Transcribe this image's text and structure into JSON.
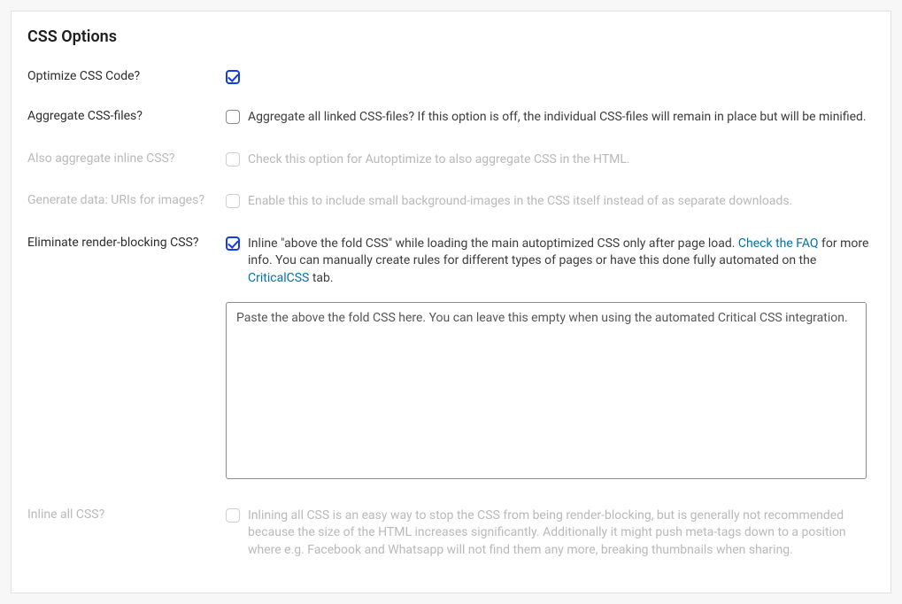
{
  "section_title": "CSS Options",
  "rows": {
    "optimize": {
      "label": "Optimize CSS Code?",
      "desc": ""
    },
    "aggregate": {
      "label": "Aggregate CSS-files?",
      "desc": "Aggregate all linked CSS-files? If this option is off, the individual CSS-files will remain in place but will be minified."
    },
    "inline_agg": {
      "label": "Also aggregate inline CSS?",
      "desc": "Check this option for Autoptimize to also aggregate CSS in the HTML."
    },
    "data_uri": {
      "label": "Generate data: URIs for images?",
      "desc": "Enable this to include small background-images in the CSS itself instead of as separate downloads."
    },
    "eliminate": {
      "label": "Eliminate render-blocking CSS?",
      "desc_1": "Inline \"above the fold CSS\" while loading the main autoptimized CSS only after page load. ",
      "link_faq": "Check the FAQ",
      "desc_2": " for more info. You can manually create rules for different types of pages or have this done fully automated on the ",
      "link_ccss": "CriticalCSS",
      "desc_3": " tab."
    },
    "textarea": {
      "placeholder": "Paste the above the fold CSS here. You can leave this empty when using the automated Critical CSS integration.",
      "value": ""
    },
    "inline_all": {
      "label": "Inline all CSS?",
      "desc": "Inlining all CSS is an easy way to stop the CSS from being render-blocking, but is generally not recommended because the size of the HTML increases significantly. Additionally it might push meta-tags down to a position where e.g. Facebook and Whatsapp will not find them any more, breaking thumbnails when sharing."
    }
  }
}
